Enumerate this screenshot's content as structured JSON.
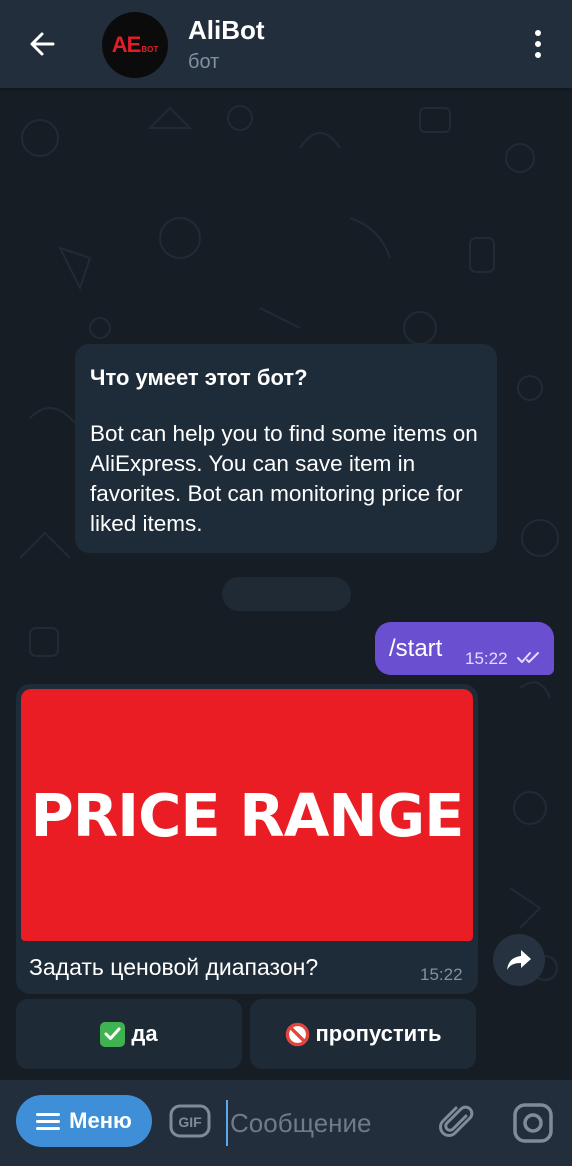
{
  "header": {
    "title": "AliBot",
    "subtitle": "бот",
    "avatar_logo_main": "AE",
    "avatar_logo_sub": "BOT"
  },
  "info_card": {
    "title": "Что умеет этот бот?",
    "text": "Bot can help you to find  some items on AliExpress. You can save item in favorites. Bot can monitoring price for liked items."
  },
  "outgoing": {
    "text": "/start",
    "time": "15:22"
  },
  "incoming": {
    "image_text": "PRICE RANGE",
    "caption": "Задать ценовой диапазон?",
    "time": "15:22"
  },
  "keyboard": {
    "yes_label": "да",
    "skip_label": "пропустить"
  },
  "composer": {
    "menu_label": "Меню",
    "gif_label": "GIF",
    "placeholder": "Сообщение"
  },
  "colors": {
    "header_bg": "#232e3c",
    "bubble_in": "#1e2b38",
    "bubble_out": "#6b4fd1",
    "accent": "#3e8fd8",
    "photo_red": "#ea1c24"
  }
}
